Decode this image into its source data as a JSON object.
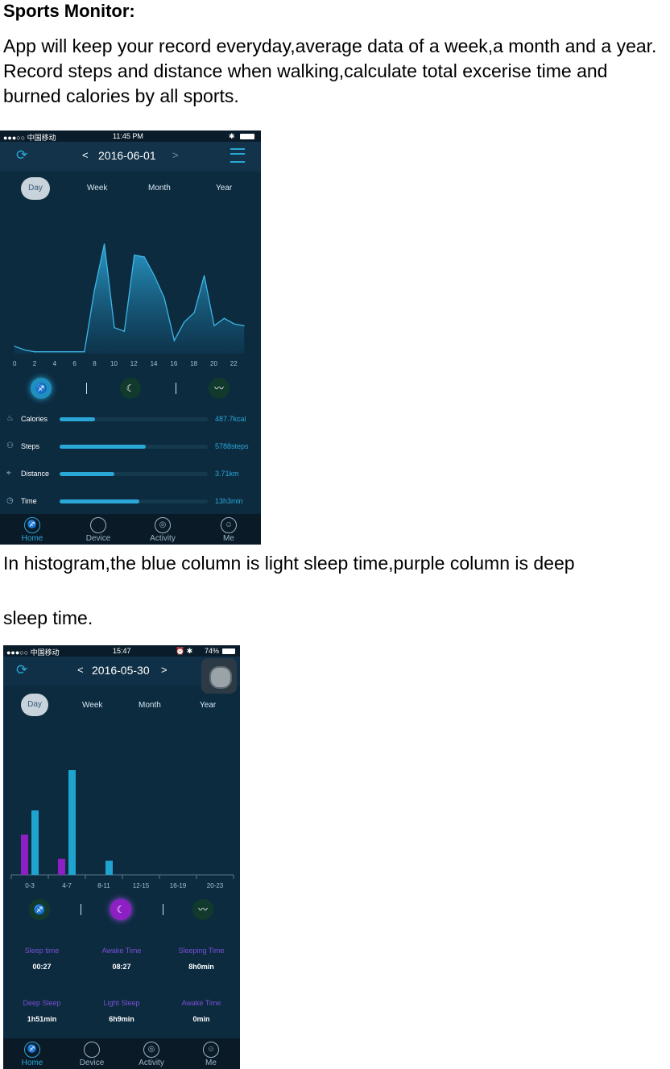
{
  "doc": {
    "title": "Sports Monitor:",
    "para1": "App will keep your record everyday,average data of a week,a month and a year. Record steps and distance when walking,calculate total excerise time and burned calories by all sports.",
    "para2": "In histogram,the blue column is light sleep time,purple column is deep",
    "para3": "sleep time."
  },
  "phone1": {
    "status": {
      "carrier": "●●●○○ 中国移动",
      "time": "11:45 PM"
    },
    "nav": {
      "prev": "<",
      "date": "2016-06-01",
      "next": ">"
    },
    "tabs": [
      "Day",
      "Week",
      "Month",
      "Year"
    ],
    "active_tab": "Day",
    "stats": [
      {
        "label": "Calories",
        "value": "487.7kcal",
        "fill": 0.24,
        "icon": "calories-icon"
      },
      {
        "label": "Steps",
        "value": "5788steps",
        "fill": 0.58,
        "icon": "steps-icon"
      },
      {
        "label": "Distance",
        "value": "3.71km",
        "fill": 0.37,
        "icon": "location-icon"
      },
      {
        "label": "Time",
        "value": "13h3min",
        "fill": 0.54,
        "icon": "clock-icon"
      }
    ],
    "tabbar": [
      "Home",
      "Device",
      "Activity",
      "Me"
    ],
    "colors": {
      "accent": "#2aa7d7",
      "background": "#0c2b3f"
    }
  },
  "phone2": {
    "status": {
      "carrier": "●●●○○ 中国移动",
      "time": "15:47",
      "battery": "74%"
    },
    "nav": {
      "prev": "<",
      "date": "2016-05-30",
      "next": ">"
    },
    "tabs": [
      "Day",
      "Week",
      "Month",
      "Year"
    ],
    "active_tab": "Day",
    "sleep_stats_row1": [
      {
        "label": "Sleep time",
        "value": "00:27"
      },
      {
        "label": "Awake Time",
        "value": "08:27"
      },
      {
        "label": "Sleeping Time",
        "value": "8h0min"
      }
    ],
    "sleep_stats_row2": [
      {
        "label": "Deep Sleep",
        "value": "1h51min"
      },
      {
        "label": "Light Sleep",
        "value": "6h9min"
      },
      {
        "label": "Awake Time",
        "value": "0min"
      }
    ],
    "tabbar": [
      "Home",
      "Device",
      "Activity",
      "Me"
    ],
    "colors": {
      "deep_sleep": "#8e1fc4",
      "light_sleep": "#1fa3cf"
    }
  },
  "chart_data": [
    {
      "type": "area",
      "x": [
        0,
        1,
        2,
        3,
        4,
        5,
        6,
        7,
        8,
        9,
        10,
        11,
        12,
        13,
        14,
        15,
        16,
        17,
        18,
        19,
        20,
        21,
        22,
        23
      ],
      "values": [
        8,
        4,
        2,
        2,
        2,
        2,
        2,
        2,
        68,
        118,
        28,
        24,
        106,
        104,
        84,
        60,
        14,
        34,
        44,
        84,
        30,
        38,
        32,
        30
      ],
      "xticks": [
        "0",
        "2",
        "4",
        "6",
        "8",
        "10",
        "12",
        "14",
        "16",
        "18",
        "20",
        "22"
      ],
      "ylim": [
        0,
        130
      ]
    },
    {
      "type": "bar",
      "categories": [
        "0-3",
        "4-7",
        "8-11",
        "12-15",
        "16-19",
        "20-23"
      ],
      "series": [
        {
          "values": [
            1.0,
            0.4,
            0,
            0,
            0,
            0
          ]
        },
        {
          "values": [
            1.6,
            2.6,
            0.35,
            0,
            0,
            0
          ]
        }
      ],
      "ylim": [
        0,
        3
      ]
    }
  ]
}
